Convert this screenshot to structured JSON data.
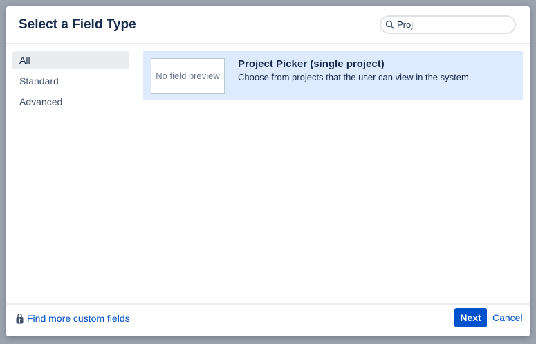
{
  "dialog": {
    "title": "Select a Field Type"
  },
  "search": {
    "value": "Proj"
  },
  "sidebar": {
    "items": [
      {
        "label": "All"
      },
      {
        "label": "Standard"
      },
      {
        "label": "Advanced"
      }
    ]
  },
  "results": [
    {
      "preview": "No field preview",
      "name": "Project Picker (single project)",
      "description": "Choose from projects that the user can view in the system."
    }
  ],
  "footer": {
    "find_more": "Find more custom fields",
    "next": "Next",
    "cancel": "Cancel"
  }
}
